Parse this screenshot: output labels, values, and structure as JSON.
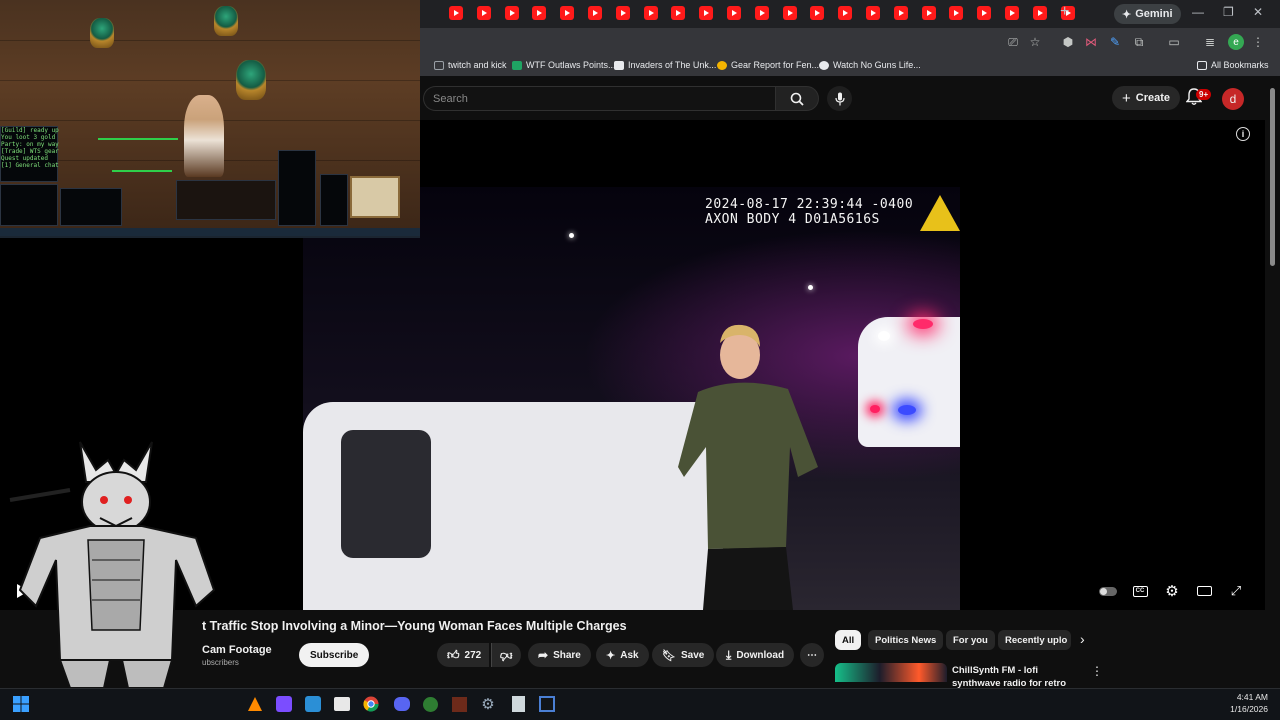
{
  "browser": {
    "tab_count": 23,
    "gemini_label": "Gemini",
    "bookmarks": [
      {
        "label": "twitch and kick",
        "color": "#9aa0a6"
      },
      {
        "label": "WTF Outlaws Points...",
        "color": "#1fa463"
      },
      {
        "label": "Invaders of The Unk...",
        "color": "#e8eaed"
      },
      {
        "label": "Gear Report for Fen...",
        "color": "#f4b400"
      },
      {
        "label": "Watch No Guns Life...",
        "color": "#e8eaed"
      }
    ],
    "all_bookmarks_label": "All Bookmarks",
    "profile_initial": "e"
  },
  "youtube": {
    "search_placeholder": "Search",
    "create_label": "Create",
    "notification_count": "9+",
    "avatar_initial": "d",
    "accent": "#ff0000"
  },
  "video": {
    "timestamp_line1": "2024-08-17 22:39:44 -0400",
    "timestamp_line2": "AXON BODY 4 D01A5616S",
    "progress_fraction": 0.02,
    "time_display": "0:",
    "title": "t Traffic Stop Involving a Minor—Young Woman Faces Multiple Charges",
    "channel": "Cam Footage",
    "subscribers": "ubscribers",
    "subscribe_label": "Subscribe",
    "like_count": "272",
    "actions": {
      "share": "Share",
      "ask": "Ask",
      "save": "Save",
      "download": "Download"
    }
  },
  "recommendations": {
    "chips": [
      "All",
      "Politics News",
      "For you",
      "Recently uplo"
    ],
    "first_title": "ChillSynth FM - lofi synthwave radio for retro dreaming"
  },
  "game_overlay": {
    "log_lines": [
      "[Guild] ready up",
      "You loot 3 gold",
      "Party: on my way",
      "[Trade] WTS gear",
      "Quest updated",
      "[1] General chat"
    ]
  },
  "taskbar": {
    "time": "4:41 AM",
    "date": "1/16/2026"
  }
}
